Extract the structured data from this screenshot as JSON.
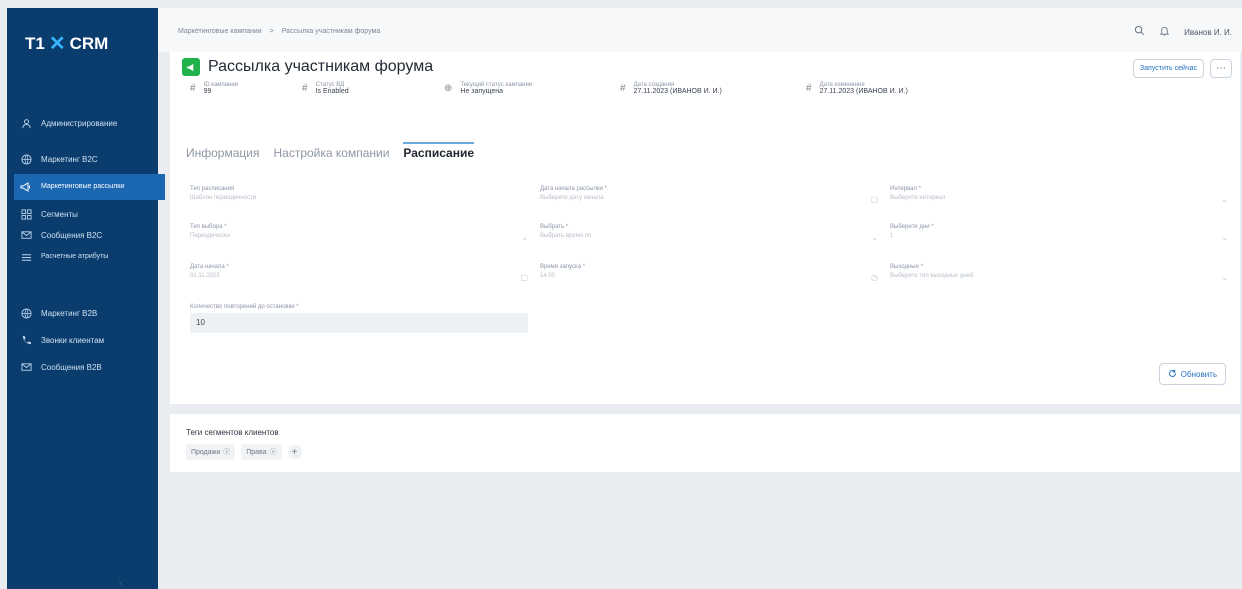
{
  "sidebar": {
    "logo_prefix": "T1",
    "logo_x": "✕",
    "logo_suffix": "CRM",
    "items": [
      {
        "label": "Администрирование",
        "icon": "users-icon"
      },
      {
        "label": "Маркетинг B2C",
        "icon": "globe-icon"
      },
      {
        "label": "Маркетинговые рассылки",
        "icon": "megaphone-icon"
      },
      {
        "label": "Сегменты",
        "icon": "grid-icon"
      },
      {
        "label": "Сообщения B2C",
        "icon": "message-icon"
      },
      {
        "label": "Расчетные атрибуты",
        "icon": "list-icon"
      },
      {
        "label": "Маркетинг B2B",
        "icon": "globe-icon"
      },
      {
        "label": "Звонки клиентам",
        "icon": "phone-icon"
      },
      {
        "label": "Сообщения B2B",
        "icon": "message-icon"
      }
    ],
    "footer": "v"
  },
  "topbar": {
    "breadcrumb": [
      "Маркетинговые кампании",
      ">",
      "Рассылка участникам форума"
    ],
    "user": "Иванов И. И."
  },
  "header": {
    "title": "Рассылка участникам форума",
    "primary_btn": "Запустить сейчас",
    "more_btn": "⋯",
    "meta": [
      {
        "label": "ID кампании",
        "value": "99"
      },
      {
        "label": "Статус ВД",
        "value": "Is Enabled"
      },
      {
        "label": "Текущий статус кампании",
        "value": "Не запущена"
      },
      {
        "label": "Дата создания",
        "value": "27.11.2023 (ИВАНОВ И. И.)"
      },
      {
        "label": "Дата изменения",
        "value": "27.11.2023 (ИВАНОВ И. И.)"
      }
    ]
  },
  "tabs": [
    "Информация",
    "Настройка компании",
    "Расписание"
  ],
  "form": {
    "fields": [
      {
        "label": "Тип расписания",
        "value": "Шаблон периодичности"
      },
      {
        "label": "Дата начала рассылки *",
        "value": "Выберите дату начала"
      },
      {
        "label": "Интервал *",
        "value": "Выберите интервал"
      },
      {
        "label": "Тип выбора *",
        "value": "Периодически"
      },
      {
        "label": "Выбрать *",
        "value": "Выбрать время по"
      },
      {
        "label": "Выберите дни *",
        "value": "1"
      },
      {
        "label": "Дата начала *",
        "value": "01.11.2023"
      },
      {
        "label": "Время запуска *",
        "value": "14:00"
      },
      {
        "label": "Выходные *",
        "value": "Выберите тип выходных дней"
      },
      {
        "label": "Количество повторений до остановки *",
        "value": "10"
      }
    ],
    "refresh_btn": "Обновить"
  },
  "tags": {
    "title": "Теги сегментов клиентов",
    "items": [
      "Продажи",
      "Права"
    ],
    "add": "+"
  }
}
